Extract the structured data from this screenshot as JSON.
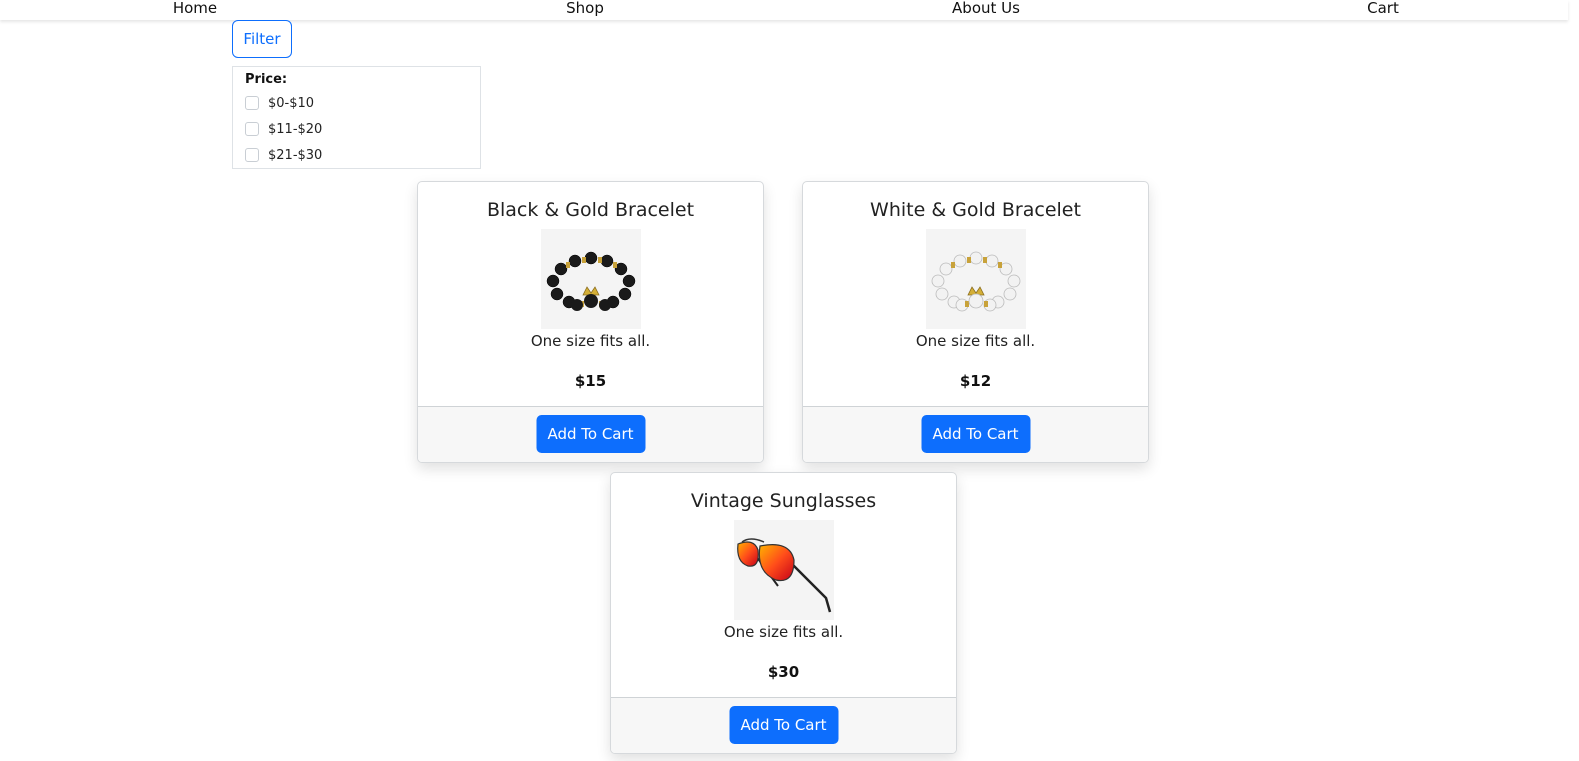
{
  "nav": {
    "items": [
      {
        "label": "Home"
      },
      {
        "label": "Shop"
      },
      {
        "label": "About Us"
      },
      {
        "label": "Cart"
      }
    ]
  },
  "filter": {
    "button_label": "Filter",
    "price_title": "Price:",
    "options": [
      {
        "label": "$0-$10",
        "checked": false
      },
      {
        "label": "$11-$20",
        "checked": false
      },
      {
        "label": "$21-$30",
        "checked": false
      }
    ]
  },
  "products": [
    {
      "title": "Black & Gold Bracelet",
      "description": "One size fits all.",
      "price": "$15",
      "button_label": "Add To Cart",
      "image": "black-gold-bracelet"
    },
    {
      "title": "White & Gold Bracelet",
      "description": "One size fits all.",
      "price": "$12",
      "button_label": "Add To Cart",
      "image": "white-gold-bracelet"
    },
    {
      "title": "Vintage Sunglasses",
      "description": "One size fits all.",
      "price": "$30",
      "button_label": "Add To Cart",
      "image": "vintage-sunglasses"
    }
  ],
  "colors": {
    "primary": "#0d6efd",
    "card_footer": "#f7f7f7",
    "border": "#dee2e6"
  }
}
